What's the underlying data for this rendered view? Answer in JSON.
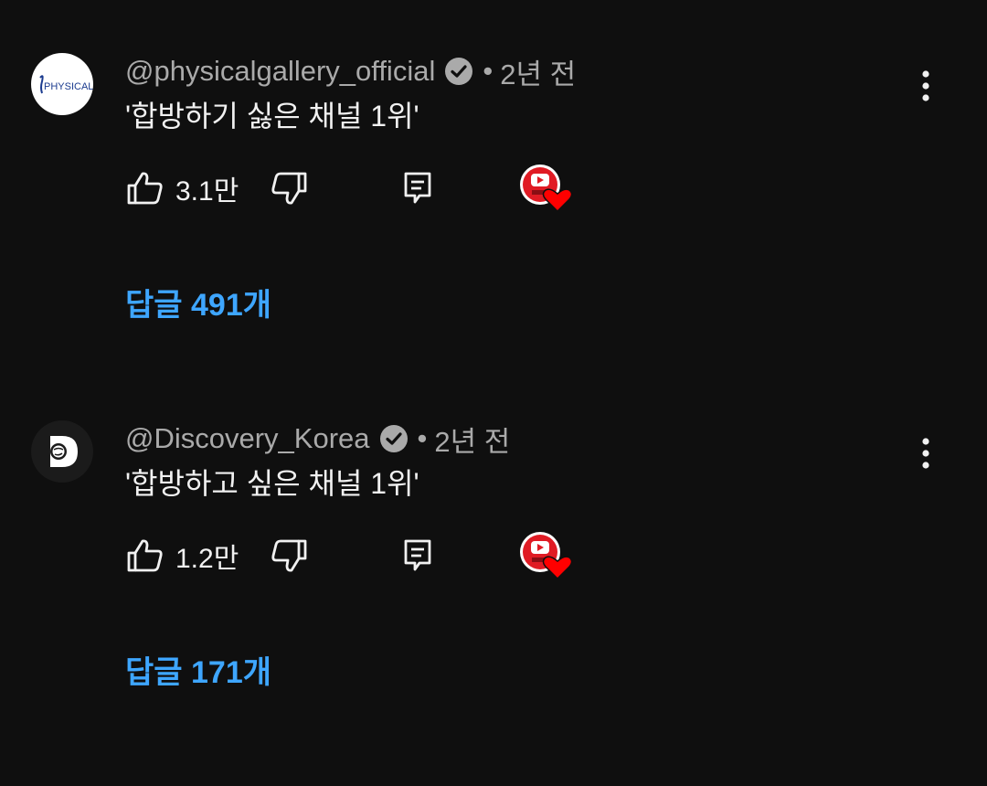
{
  "comments": [
    {
      "avatar_logo_text": "PHYSICAL",
      "author": "@physicalgallery_official",
      "dot": "•",
      "time": "2년 전",
      "text": "'합방하기 싫은 채널 1위'",
      "likes": "3.1만",
      "replies": "답글 491개",
      "verified": true,
      "hearted": true
    },
    {
      "avatar_logo_text": "D",
      "author": "@Discovery_Korea",
      "dot": "•",
      "time": "2년 전",
      "text": "'합방하고 싶은 채널 1위'",
      "likes": "1.2만",
      "replies": "답글 171개",
      "verified": true,
      "hearted": true
    }
  ],
  "colors": {
    "background": "#0f0f0f",
    "meta_text": "#aaaaaa",
    "body_text": "#f1f1f1",
    "link": "#3ea6ff",
    "heart": "#ff0000"
  },
  "icons": {
    "like": "thumbs-up-icon",
    "dislike": "thumbs-down-icon",
    "reply": "reply-icon",
    "more": "more-vert-icon",
    "verified": "verified-check-icon",
    "creator_heart": "creator-heart-icon"
  }
}
